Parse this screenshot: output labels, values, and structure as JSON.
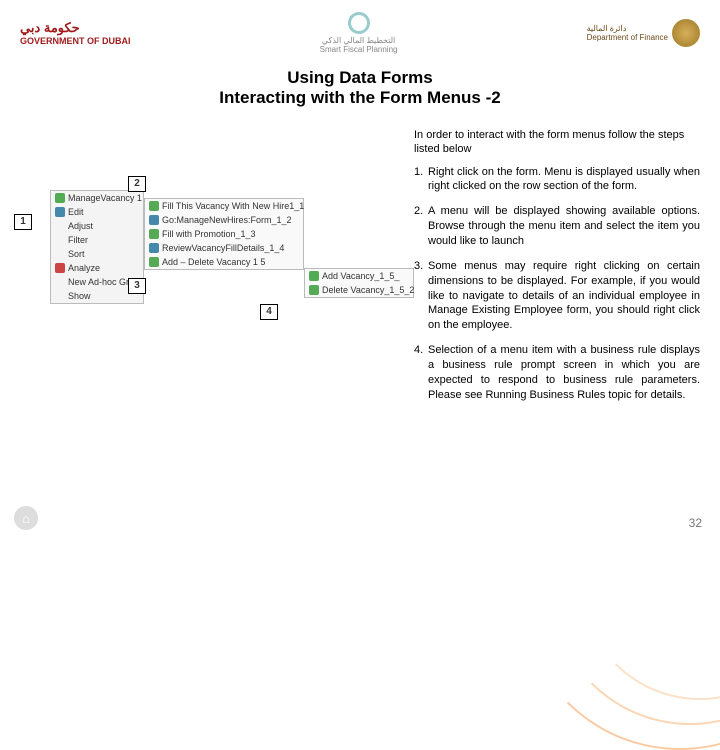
{
  "header": {
    "left": {
      "line1": "حكومة دبي",
      "line2": "GOVERNMENT OF DUBAI"
    },
    "center": {
      "line1": "التخطيط المالي الذكي",
      "line2": "Smart Fiscal Planning"
    },
    "right": {
      "line1": "دائرة المالية",
      "line2": "Department of Finance"
    }
  },
  "title": {
    "line1": "Using Data Forms",
    "line2": "Interacting with the Form Menus -2"
  },
  "intro": "In order to interact with the form menus follow the steps listed below",
  "steps": [
    {
      "n": "1.",
      "t": "Right click on the form. Menu is displayed usually when right clicked on the row section of the form."
    },
    {
      "n": "2.",
      "t": "A menu will be displayed showing available options. Browse through the menu item and select the item you would like to launch"
    },
    {
      "n": "3.",
      "t": "Some menus may require right clicking on certain dimensions to be displayed. For example, if you would like to navigate to details of an individual employee in Manage Existing Employee form, you should right click on the employee."
    },
    {
      "n": "4.",
      "t": "Selection of a menu item with a business rule displays a business rule prompt screen in which you are expected to respond to business rule parameters. Please see Running Business Rules topic for details."
    }
  ],
  "menu1": [
    "ManageVacancy 1",
    "Edit",
    "Adjust",
    "Filter",
    "Sort",
    "Analyze",
    "New Ad-hoc Grid",
    "Show"
  ],
  "menu2": [
    "Fill This Vacancy With New Hire1_1",
    "Go:ManageNewHires:Form_1_2",
    "Fill with Promotion_1_3",
    "ReviewVacancyFillDetails_1_4",
    "Add – Delete Vacancy 1 5"
  ],
  "menu3": [
    "Add Vacancy_1_5_",
    "Delete Vacancy_1_5_2"
  ],
  "callouts": {
    "c1": "1",
    "c2": "2",
    "c3": "3",
    "c4": "4"
  },
  "pagenum": "32"
}
